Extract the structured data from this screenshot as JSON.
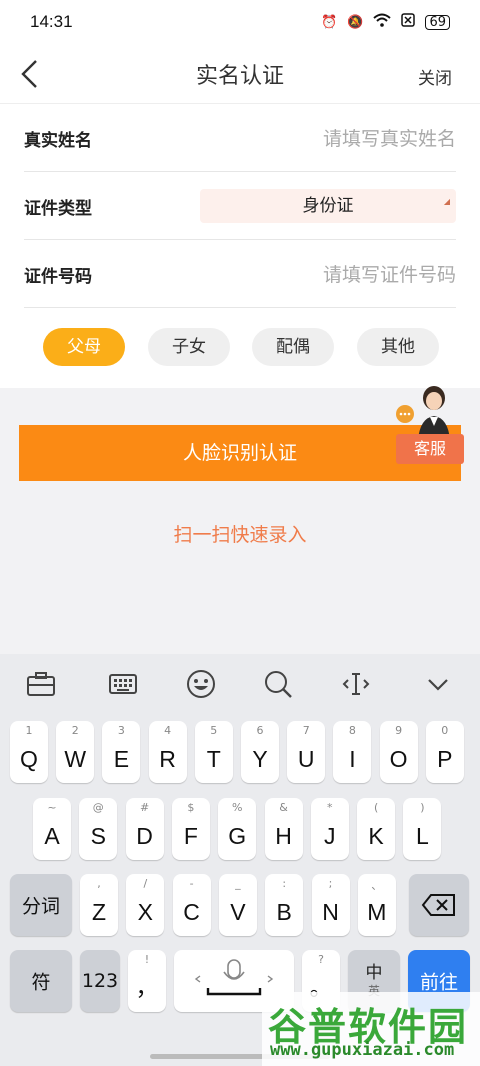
{
  "status": {
    "time": "14:31",
    "battery": "69"
  },
  "nav": {
    "title": "实名认证",
    "close": "关闭"
  },
  "form": {
    "name_label": "真实姓名",
    "name_placeholder": "请填写真实姓名",
    "type_label": "证件类型",
    "type_value": "身份证",
    "number_label": "证件号码",
    "number_placeholder": "请填写证件号码"
  },
  "chips": [
    {
      "label": "父母",
      "selected": true
    },
    {
      "label": "子女",
      "selected": false
    },
    {
      "label": "配偶",
      "selected": false
    },
    {
      "label": "其他",
      "selected": false
    }
  ],
  "face_button": "人脸识别认证",
  "service": "客服",
  "scan_link": "扫一扫快速录入",
  "keyboard": {
    "row1": [
      [
        "1",
        "Q"
      ],
      [
        "2",
        "W"
      ],
      [
        "3",
        "E"
      ],
      [
        "4",
        "R"
      ],
      [
        "5",
        "T"
      ],
      [
        "6",
        "Y"
      ],
      [
        "7",
        "U"
      ],
      [
        "8",
        "I"
      ],
      [
        "9",
        "O"
      ],
      [
        "0",
        "P"
      ]
    ],
    "row2": [
      [
        "~",
        "A"
      ],
      [
        "@",
        "S"
      ],
      [
        "#",
        "D"
      ],
      [
        "$",
        "F"
      ],
      [
        "%",
        "G"
      ],
      [
        "&",
        "H"
      ],
      [
        "*",
        "J"
      ],
      [
        "(",
        "K"
      ],
      [
        ")",
        "L"
      ]
    ],
    "row3": [
      [
        ",",
        "Z"
      ],
      [
        "/",
        "X"
      ],
      [
        "-",
        "C"
      ],
      [
        "_",
        "V"
      ],
      [
        ":",
        "B"
      ],
      [
        ";",
        "N"
      ],
      [
        "、",
        "M"
      ]
    ],
    "fenci": "分词",
    "fu": "符",
    "num": "123",
    "comma_top": "!",
    "comma": "，",
    "period_top": "?",
    "period": "。",
    "lang_top": "中",
    "lang_bottom": "英",
    "go": "前往"
  },
  "watermark": {
    "title": "谷普软件园",
    "url": "www.gupuxiazai.com"
  },
  "colors": {
    "accent": "#fb8a14",
    "chip_active": "#fbae18",
    "link": "#f07c4a",
    "go_key": "#2f7ff0"
  }
}
